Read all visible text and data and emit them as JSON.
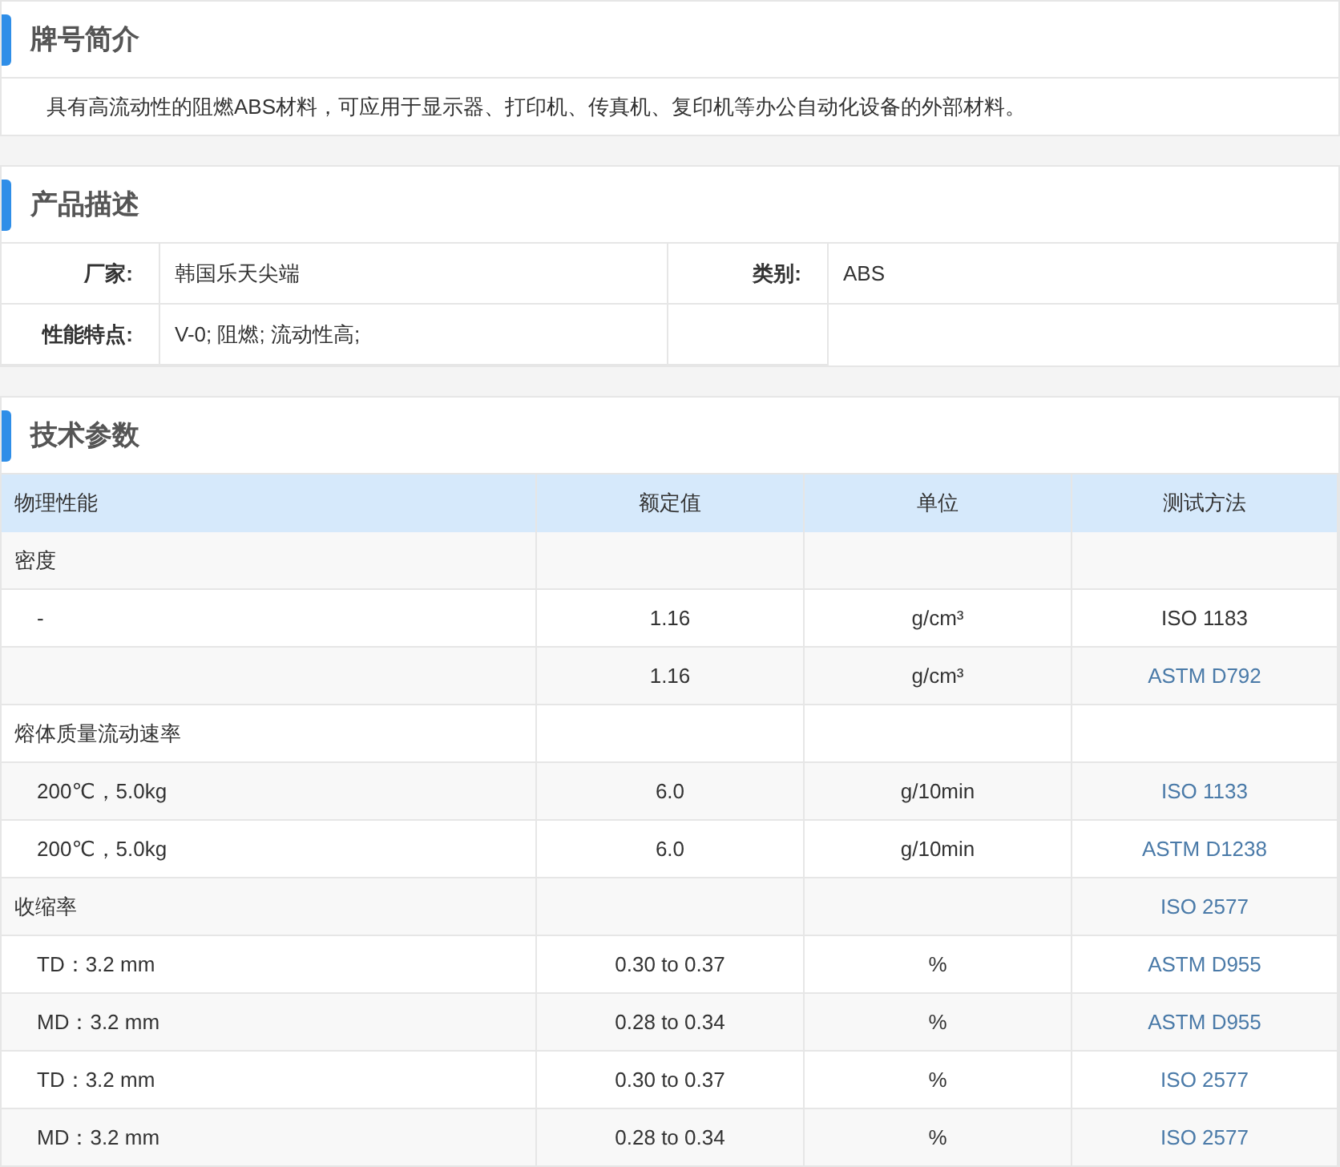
{
  "intro": {
    "title": "牌号简介",
    "text": "具有高流动性的阻燃ABS材料，可应用于显示器、打印机、传真机、复印机等办公自动化设备的外部材料。"
  },
  "description": {
    "title": "产品描述",
    "rows": [
      {
        "cells": [
          {
            "label": "厂家:",
            "value": "韩国乐天尖端"
          },
          {
            "label": "类别:",
            "value": "ABS"
          }
        ]
      },
      {
        "cells": [
          {
            "label": "性能特点:",
            "value": "V-0; 阻燃; 流动性高;"
          }
        ]
      }
    ]
  },
  "specs": {
    "title": "技术参数",
    "columns": [
      "物理性能",
      "额定值",
      "单位",
      "测试方法"
    ],
    "rows": [
      {
        "kind": "group",
        "property": "密度"
      },
      {
        "kind": "item",
        "property": "-",
        "value": "1.16",
        "unit": "g/cm³",
        "method": "ISO 1183",
        "method_link": false
      },
      {
        "kind": "item",
        "value": "1.16",
        "unit": "g/cm³",
        "method": "ASTM D792",
        "method_link": true
      },
      {
        "kind": "group",
        "property": "熔体质量流动速率"
      },
      {
        "kind": "item",
        "property": "200℃，5.0kg",
        "value": "6.0",
        "unit": "g/10min",
        "method": "ISO 1133",
        "method_link": true
      },
      {
        "kind": "item",
        "property": "200℃，5.0kg",
        "value": "6.0",
        "unit": "g/10min",
        "method": "ASTM D1238",
        "method_link": true
      },
      {
        "kind": "group",
        "property": "收缩率",
        "method": "ISO 2577",
        "method_link": true
      },
      {
        "kind": "item",
        "property": "TD：3.2 mm",
        "value": "0.30 to 0.37",
        "unit": "%",
        "method": "ASTM D955",
        "method_link": true
      },
      {
        "kind": "item",
        "property": "MD：3.2 mm",
        "value": "0.28 to 0.34",
        "unit": "%",
        "method": "ASTM D955",
        "method_link": true
      },
      {
        "kind": "item",
        "property": "TD：3.2 mm",
        "value": "0.30 to 0.37",
        "unit": "%",
        "method": "ISO 2577",
        "method_link": true
      },
      {
        "kind": "item",
        "property": "MD：3.2 mm",
        "value": "0.28 to 0.34",
        "unit": "%",
        "method": "ISO 2577",
        "method_link": true
      }
    ]
  }
}
